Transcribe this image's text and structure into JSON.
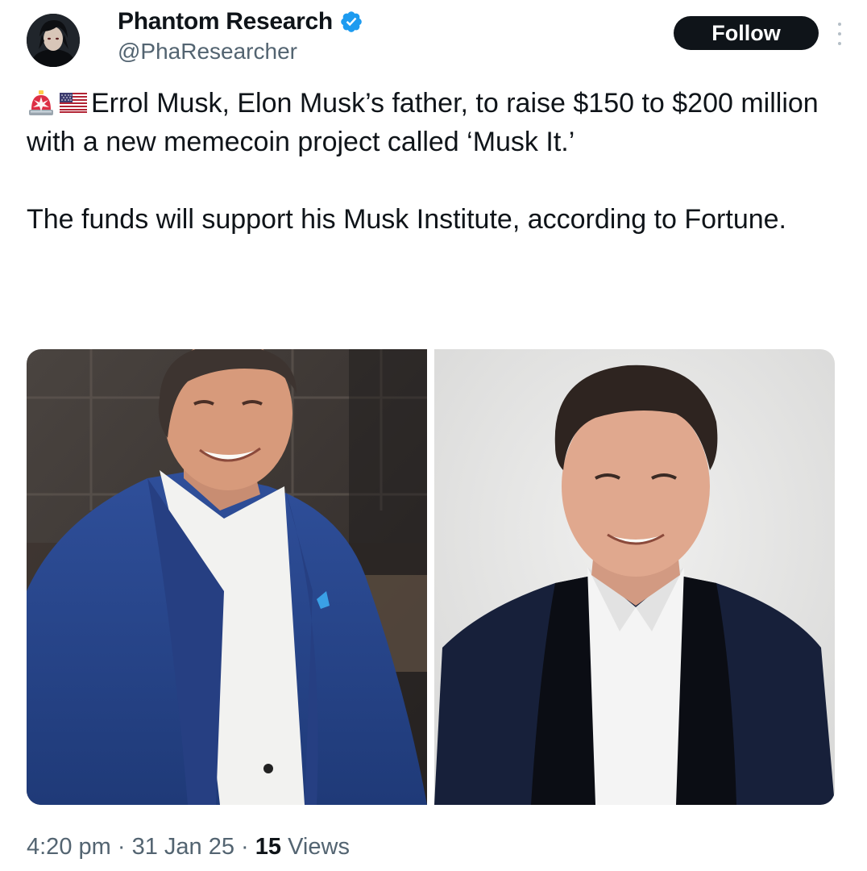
{
  "author": {
    "display_name": "Phantom Research",
    "handle": "@PhaResearcher",
    "verified": true,
    "verified_color": "#1d9bf0",
    "avatar_icon": "anime-character-avatar"
  },
  "follow_button": {
    "label": "Follow"
  },
  "tweet": {
    "emojis": [
      "police-light-emoji",
      "us-flag-emoji"
    ],
    "paragraph_1": "Errol Musk, Elon Musk’s father, to raise $150 to $200 million with a new memecoin project called ‘Musk It.’",
    "paragraph_2": "The funds will support his Musk Institute, according to Fortune."
  },
  "media": [
    {
      "description_icon": "photo-errol-musk"
    },
    {
      "description_icon": "photo-elon-musk"
    }
  ],
  "meta": {
    "time": "4:20 pm",
    "separator": "·",
    "date": "31 Jan 25",
    "views_count": "15",
    "views_label": "Views"
  },
  "colors": {
    "text_primary": "#0f1419",
    "text_secondary": "#536471",
    "follow_bg": "#0f1419"
  }
}
